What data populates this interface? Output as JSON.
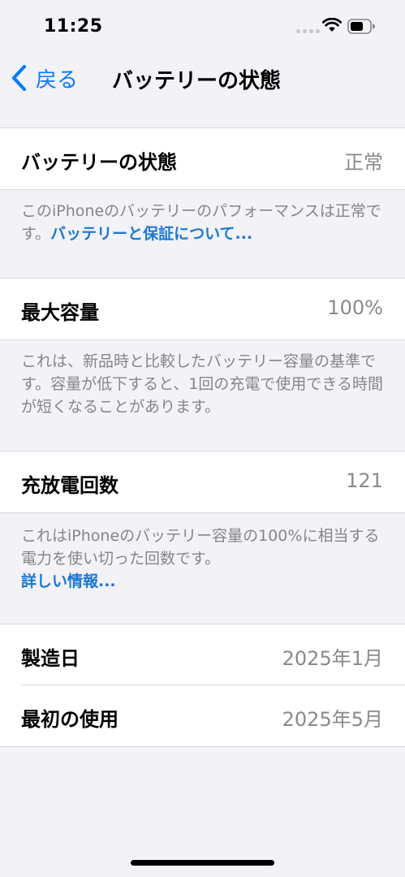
{
  "status_bar": {
    "time": "11:25",
    "icons": [
      "signal-dots-icon",
      "wifi-icon",
      "battery-icon"
    ]
  },
  "nav": {
    "back_label": "戻る",
    "title": "バッテリーの状態"
  },
  "battery_health": {
    "label": "バッテリーの状態",
    "value": "正常",
    "note": "このiPhoneのバッテリーのパフォーマンスは正常です。",
    "link": "バッテリーと保証について..."
  },
  "max_capacity": {
    "label": "最大容量",
    "value": "100%",
    "note": "これは、新品時と比較したバッテリー容量の基準です。容量が低下すると、1回の充電で使用できる時間が短くなることがあります。"
  },
  "cycle_count": {
    "label": "充放電回数",
    "value": "121",
    "note": "これはiPhoneのバッテリー容量の100%に相当する電力を使い切った回数です。",
    "link": "詳しい情報..."
  },
  "dates": {
    "manufacture_label": "製造日",
    "manufacture_value": "2025年1月",
    "first_use_label": "最初の使用",
    "first_use_value": "2025年5月"
  },
  "colors": {
    "accent": "#0a7aff",
    "background": "#f2f2f7",
    "secondary_text": "#8a8a8e"
  }
}
